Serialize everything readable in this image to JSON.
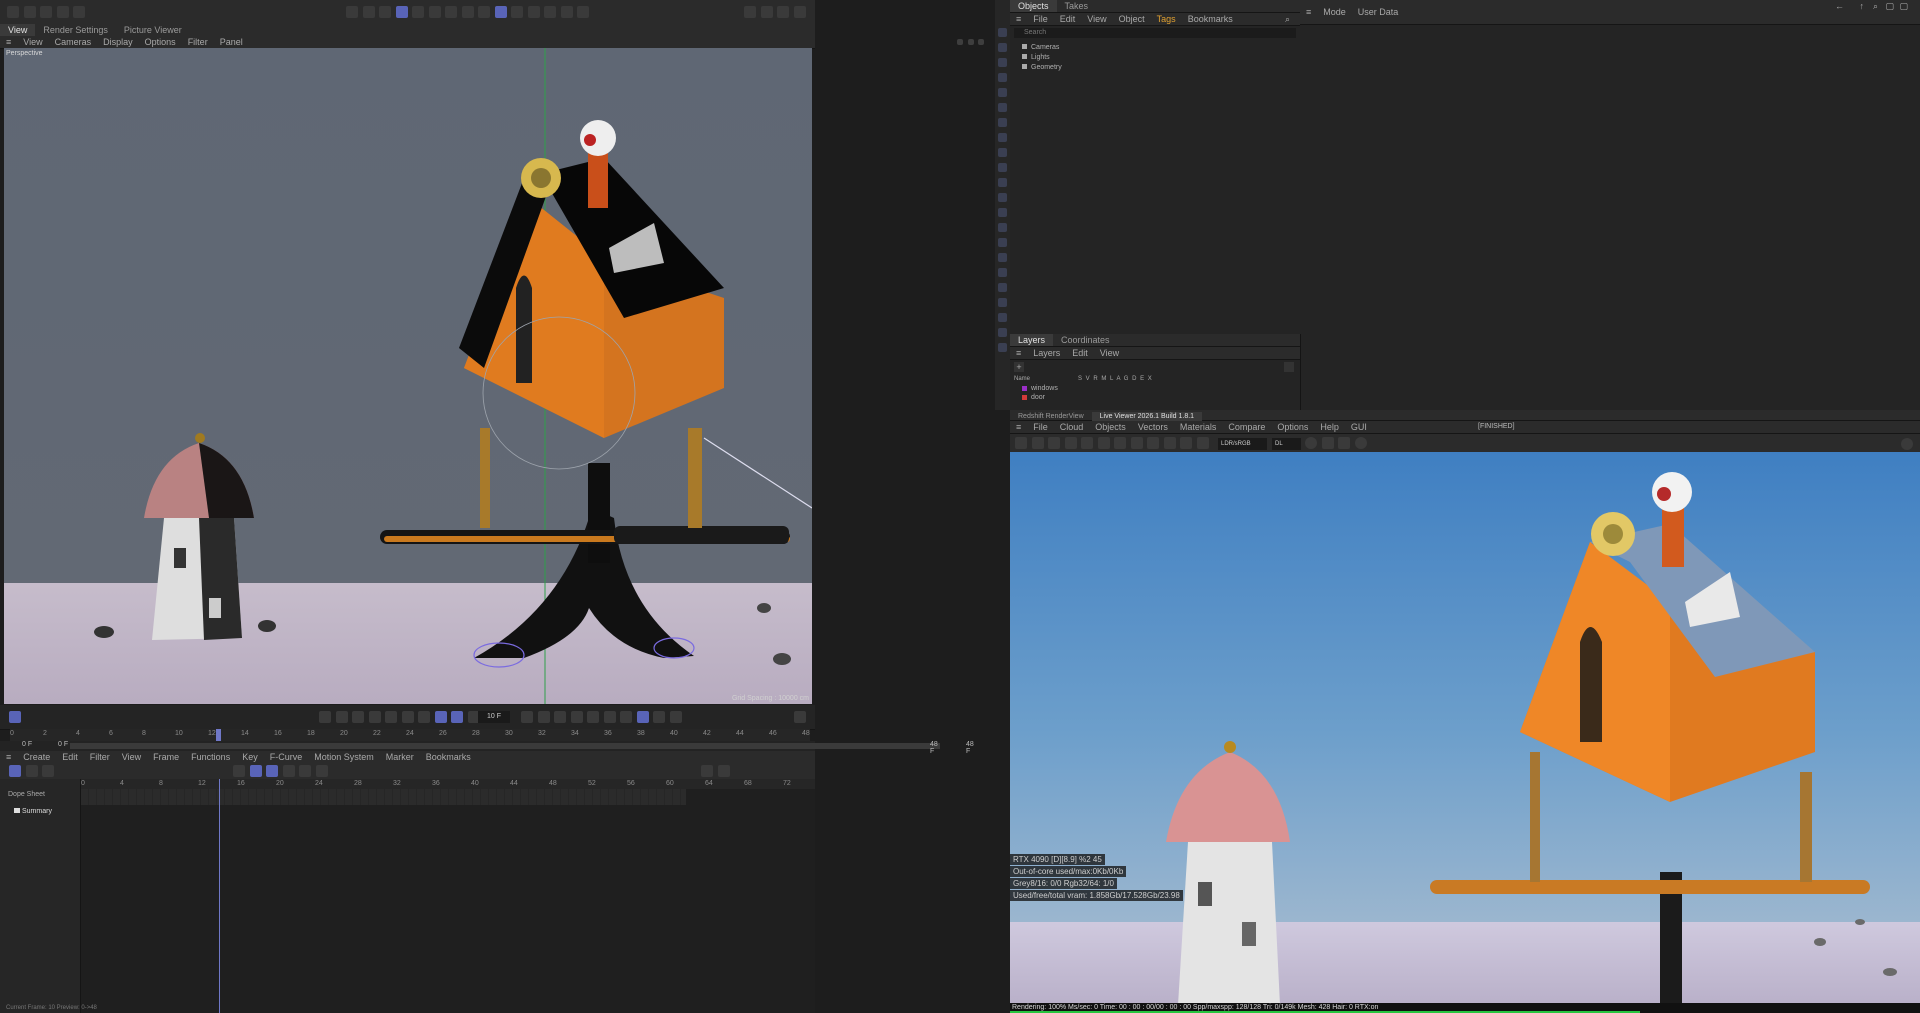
{
  "viewport": {
    "tabs": [
      "View",
      "Render Settings",
      "Picture Viewer"
    ],
    "menu": [
      "View",
      "Cameras",
      "Display",
      "Options",
      "Filter",
      "Panel"
    ],
    "label": "Perspective",
    "grid_spacing": "Grid Spacing : 10000 cm"
  },
  "timeline": {
    "ticks": [
      "0",
      "2",
      "4",
      "6",
      "8",
      "10",
      "12",
      "14",
      "16",
      "18",
      "20",
      "22",
      "24",
      "26",
      "28",
      "30",
      "32",
      "34",
      "36",
      "38",
      "40",
      "42",
      "44",
      "46",
      "48"
    ],
    "current_frame": "10 F",
    "start_frame": "0 F",
    "start_frame2": "0 F",
    "end_frame": "48 F",
    "end_frame2": "48 F"
  },
  "dopesheet": {
    "menu": [
      "Create",
      "Edit",
      "Filter",
      "View",
      "Frame",
      "Functions",
      "Key",
      "F-Curve",
      "Motion System",
      "Marker",
      "Bookmarks"
    ],
    "ticks": [
      "0",
      "4",
      "8",
      "12",
      "16",
      "20",
      "24",
      "28",
      "32",
      "36",
      "40",
      "44",
      "48",
      "52",
      "56",
      "60",
      "64",
      "68",
      "72"
    ],
    "title": "Dope Sheet",
    "summary": "Summary",
    "status": "Current Frame: 10 Preview: 0->48"
  },
  "objects": {
    "tabs": [
      "Objects",
      "Takes"
    ],
    "menu": [
      "File",
      "Edit",
      "View",
      "Object",
      "Tags",
      "Bookmarks"
    ],
    "search_placeholder": "Search",
    "items": [
      "Cameras",
      "Lights",
      "Geometry"
    ]
  },
  "attributes": {
    "menu": [
      "Mode",
      "User Data"
    ]
  },
  "layers": {
    "tabs": [
      "Layers",
      "Coordinates"
    ],
    "menu": [
      "Layers",
      "Edit",
      "View"
    ],
    "name_header": "Name",
    "columns": "S V R M L A G D E X",
    "items": [
      {
        "name": "windows",
        "color": "#9b2fc8"
      },
      {
        "name": "door",
        "color": "#d23a3a"
      }
    ]
  },
  "renderview": {
    "tabs": [
      "Redshift RenderView",
      "Live Viewer 2026.1 Build 1.8.1"
    ],
    "menu": [
      "File",
      "Cloud",
      "Objects",
      "Vectors",
      "Materials",
      "Compare",
      "Options",
      "Help",
      "GUI"
    ],
    "finished": "[FINISHED]",
    "lut": "LDR/sRGB",
    "mode": "DL",
    "stats": [
      "RTX 4090 [D][8.9]          %2     45",
      "Out-of-core used/max:0Kb/0Kb",
      "Grey8/16: 0/0          Rgb32/64: 1/0",
      "Used/free/total vram: 1.858Gb/17.528Gb/23.98"
    ],
    "status": "Rendering: 100%  Ms/sec: 0    Time: 00 : 00 : 00/00 : 00 : 00   Spp/maxspp: 128/128   Tri: 0/149k   Mesh: 428   Hair: 0     RTX:on"
  }
}
